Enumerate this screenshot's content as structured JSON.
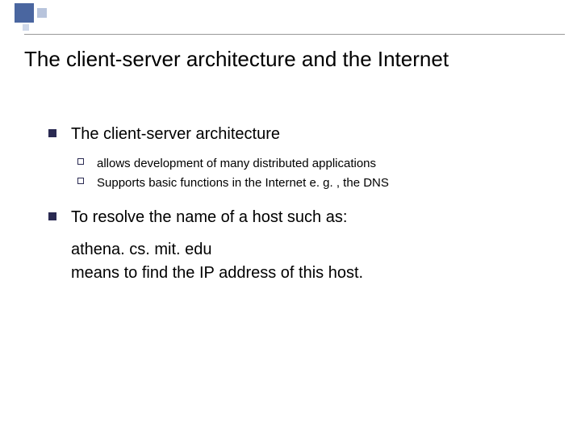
{
  "slide": {
    "title": "The client-server architecture and the Internet",
    "bullets": [
      {
        "text": "The client-server architecture",
        "children": [
          {
            "text": "allows development of many distributed applications"
          },
          {
            "text": "Supports basic functions in the Internet e. g. , the DNS"
          }
        ]
      },
      {
        "text": "To resolve the name of a host such as:",
        "continuation": [
          "athena. cs. mit. edu",
          "means to find the IP address of this host."
        ]
      }
    ]
  }
}
